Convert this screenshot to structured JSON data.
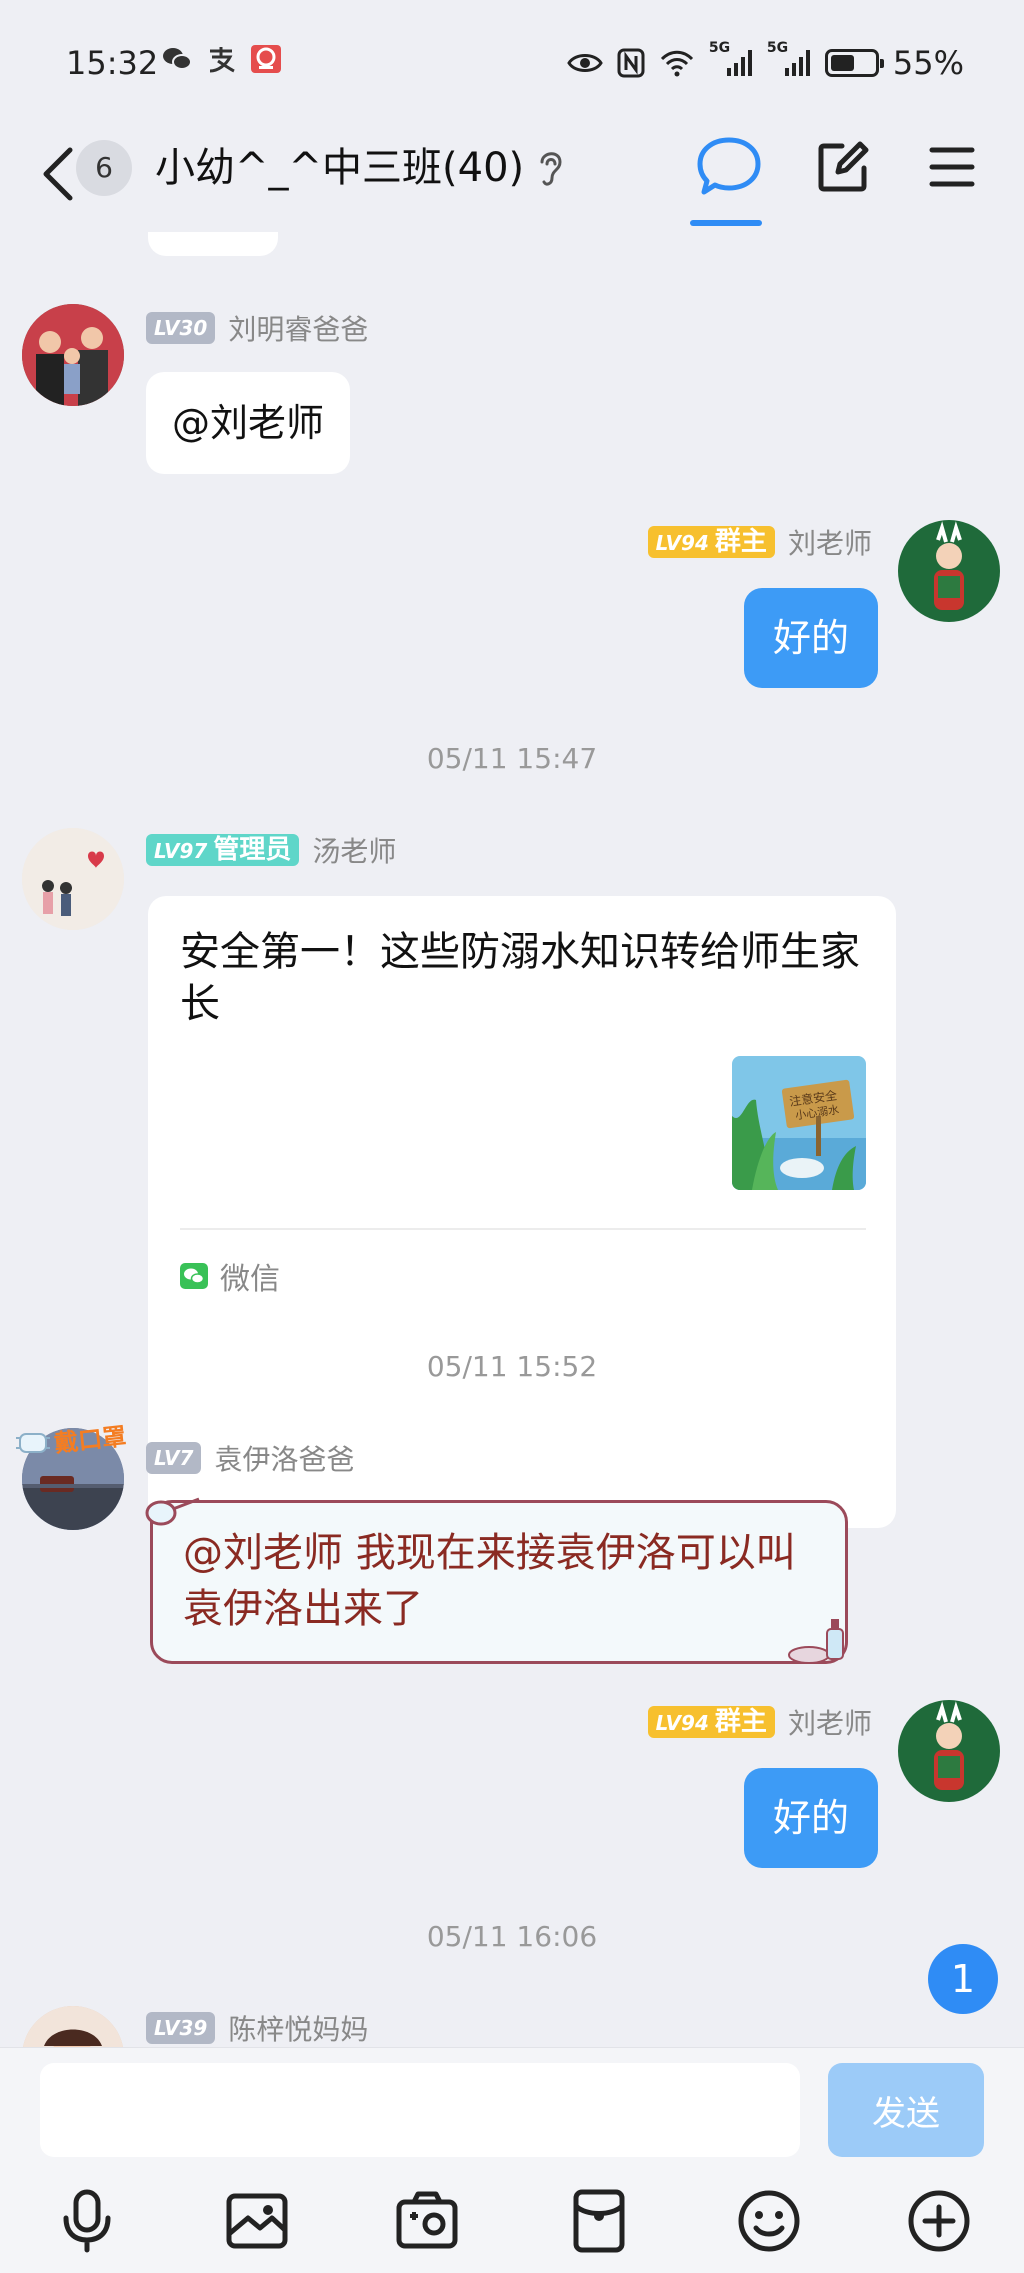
{
  "status": {
    "time": "15:32",
    "app_icons": [
      "wechat-icon",
      "alipay-icon",
      "app-icon"
    ],
    "right_icons": [
      "eye-icon",
      "nfc-icon",
      "wifi-icon",
      "5g-signal-icon",
      "5g-signal-icon"
    ],
    "sig1": "5G",
    "sig2": "5G",
    "battery": "55%",
    "battery_level": 0.55
  },
  "header": {
    "unread_count": "6",
    "title": "小幼^_^中三班(40)",
    "active_tab": "chat"
  },
  "messages": {
    "m1": {
      "level": "LV30",
      "sender": "刘明睿爸爸",
      "text": "@刘老师"
    },
    "m2": {
      "level": "LV94",
      "role": "群主",
      "sender": "刘老师",
      "text": "好的"
    },
    "ts1": "05/11 15:47",
    "m3": {
      "level": "LV97",
      "role": "管理员",
      "sender": "汤老师",
      "card_title": "安全第一！这些防溺水知识转给师生家长",
      "thumb_text_1": "注意安全",
      "thumb_text_2": "小心溺水",
      "source": "微信"
    },
    "ts2": "05/11 15:52",
    "m4": {
      "level": "LV7",
      "sender": "袁伊洛爸爸",
      "avatar_tag": "戴口罩",
      "text": "@刘老师  我现在来接袁伊洛可以叫袁伊洛出来了"
    },
    "m5": {
      "level": "LV94",
      "role": "群主",
      "sender": "刘老师",
      "text": "好的"
    },
    "ts3": "05/11 16:06",
    "m6": {
      "level": "LV39",
      "sender": "陈梓悦妈妈"
    }
  },
  "scroll_badge": "1",
  "input": {
    "placeholder": "",
    "send_label": "发送"
  },
  "toolbar": [
    "mic-icon",
    "image-icon",
    "camera-icon",
    "file-icon",
    "emoji-icon",
    "plus-icon"
  ],
  "colors": {
    "accent": "#2f8cf5",
    "bubble_blue": "#3d9bf6",
    "send_disabled": "#9ccbf8",
    "background": "#eeeff4"
  }
}
